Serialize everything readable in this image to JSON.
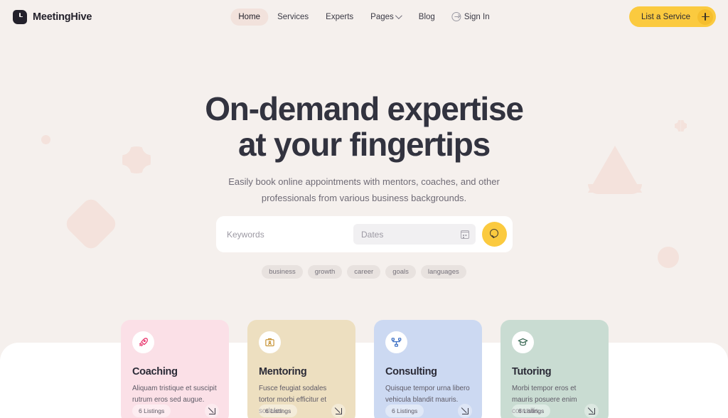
{
  "brand": {
    "name": "MeetingHive",
    "logo_icon": "clock-icon"
  },
  "nav": {
    "items": [
      {
        "label": "Home",
        "active": true,
        "icon": null
      },
      {
        "label": "Services",
        "active": false,
        "icon": null
      },
      {
        "label": "Experts",
        "active": false,
        "icon": null
      },
      {
        "label": "Pages",
        "active": false,
        "icon": "chevron-down-icon"
      },
      {
        "label": "Blog",
        "active": false,
        "icon": null
      },
      {
        "label": "Sign In",
        "active": false,
        "icon": "sign-in-arrow-icon"
      }
    ]
  },
  "cta": {
    "label": "List a Service",
    "icon": "plus-icon",
    "color": "#FBCA3F"
  },
  "hero": {
    "title_line1": "On-demand expertise",
    "title_line2": "at your fingertips",
    "subtitle_line1": "Easily book online appointments with mentors, coaches, and other",
    "subtitle_line2": "professionals from various business backgrounds."
  },
  "search": {
    "keywords_placeholder": "Keywords",
    "dates_placeholder": "Dates",
    "calendar_icon": "calendar-icon",
    "search_icon": "search-icon"
  },
  "tags": [
    {
      "label": "business"
    },
    {
      "label": "growth"
    },
    {
      "label": "career"
    },
    {
      "label": "goals"
    },
    {
      "label": "languages"
    }
  ],
  "cards": [
    {
      "title": "Coaching",
      "desc": "Aliquam tristique et suscipit rutrum eros sed augue.",
      "listings": "6 Listings",
      "icon": "rocket-icon",
      "color": "#FBE0E7",
      "icon_color": "#E8356D"
    },
    {
      "title": "Mentoring",
      "desc": "Fusce feugiat sodales tortor morbi efficitur et sodales.",
      "listings": "6 Listings",
      "icon": "id-badge-icon",
      "color": "#EDDFC0",
      "icon_color": "#C8963A"
    },
    {
      "title": "Consulting",
      "desc": "Quisque tempor urna libero vehicula blandit mauris.",
      "listings": "6 Listings",
      "icon": "network-icon",
      "color": "#CCD9F2",
      "icon_color": "#3C6FC4"
    },
    {
      "title": "Tutoring",
      "desc": "Morbi tempor eros et mauris posuere enim convallis.",
      "listings": "6 Listings",
      "icon": "graduation-cap-icon",
      "color": "#C9DCD2",
      "icon_color": "#3D6B57"
    }
  ],
  "theme": {
    "page_bg": "#F5F0ED",
    "sheet_bg": "#FFFFFF",
    "deco_color": "#F4E2DC",
    "text_dark": "#32333F",
    "text_muted": "#6F6B76"
  }
}
